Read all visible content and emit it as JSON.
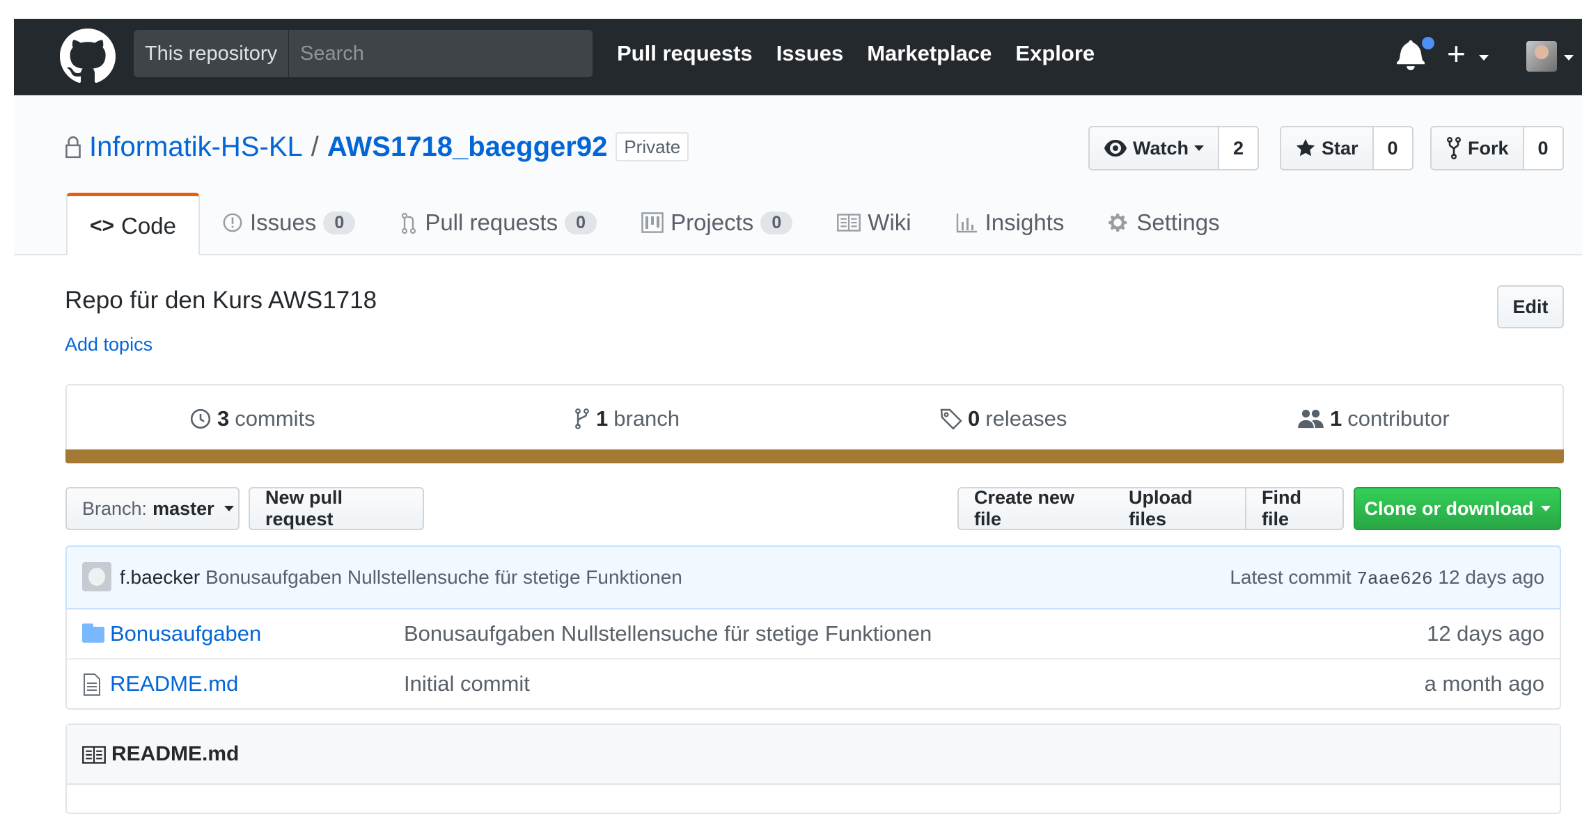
{
  "header": {
    "scope_label": "This repository",
    "search_placeholder": "Search",
    "nav": [
      "Pull requests",
      "Issues",
      "Marketplace",
      "Explore"
    ],
    "icons": [
      "github-mark-icon",
      "bell-icon",
      "plus-icon",
      "avatar"
    ]
  },
  "repo": {
    "owner": "Informatik-HS-KL",
    "separator": "/",
    "name": "AWS1718_baegger92",
    "visibility": "Private",
    "watch_label": "Watch",
    "watch_count": "2",
    "star_label": "Star",
    "star_count": "0",
    "fork_label": "Fork",
    "fork_count": "0"
  },
  "tabs": [
    {
      "label": "Code",
      "icon": "code-icon",
      "selected": true
    },
    {
      "label": "Issues",
      "counter": "0",
      "icon": "issue-icon"
    },
    {
      "label": "Pull requests",
      "counter": "0",
      "icon": "pull-request-icon"
    },
    {
      "label": "Projects",
      "counter": "0",
      "icon": "project-icon"
    },
    {
      "label": "Wiki",
      "icon": "book-icon"
    },
    {
      "label": "Insights",
      "icon": "graph-icon"
    },
    {
      "label": "Settings",
      "icon": "gear-icon"
    }
  ],
  "description": {
    "text": "Repo für den Kurs AWS1718",
    "topics_link": "Add topics",
    "edit_label": "Edit"
  },
  "summary": {
    "commits_count": "3",
    "commits_label": "commits",
    "branch_count": "1",
    "branch_label": "branch",
    "releases_count": "0",
    "releases_label": "releases",
    "contributors_count": "1",
    "contributors_label": "contributor",
    "language_color": "#a47933"
  },
  "file_nav": {
    "branch_prefix": "Branch:",
    "branch_name": "master",
    "new_pr": "New pull request",
    "create_file": "Create new file",
    "upload_files": "Upload files",
    "find_file": "Find file",
    "clone": "Clone or download"
  },
  "latest_commit": {
    "author": "f.baecker",
    "message": "Bonusaufgaben Nullstellensuche für stetige Funktionen",
    "prefix": "Latest commit",
    "sha": "7aae626",
    "age": "12 days ago"
  },
  "files": [
    {
      "name": "Bonusaufgaben",
      "type": "folder",
      "message": "Bonusaufgaben Nullstellensuche für stetige Funktionen",
      "age": "12 days ago"
    },
    {
      "name": "README.md",
      "type": "file",
      "message": "Initial commit",
      "age": "a month ago"
    }
  ],
  "readme": {
    "title": "README.md"
  }
}
